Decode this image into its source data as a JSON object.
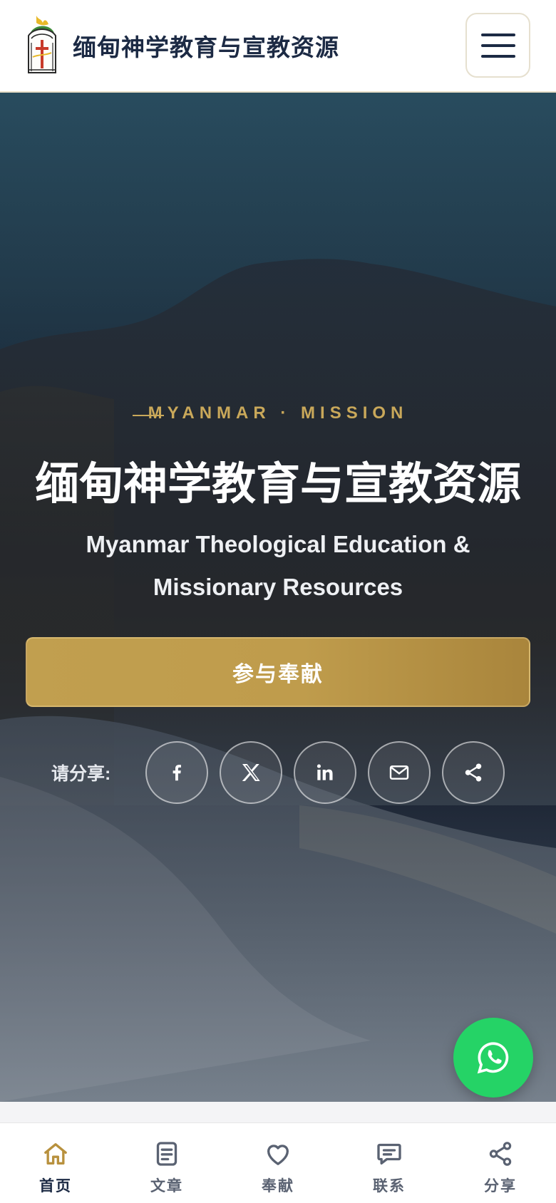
{
  "header": {
    "site_title": "缅甸神学教育与宣教资源",
    "logo_icon": "cross-emblem-icon",
    "menu_icon": "hamburger-menu-icon"
  },
  "hero": {
    "eyebrow": "MYANMAR · MISSION",
    "title": "缅甸神学教育与宣教资源",
    "subtitle": "Myanmar Theological Education & Missionary Resources",
    "cta_label": "参与奉献",
    "share_label": "请分享:",
    "share_buttons": [
      "facebook-icon",
      "x-twitter-icon",
      "linkedin-icon",
      "email-icon",
      "share-icon"
    ]
  },
  "floating": {
    "whatsapp_icon": "whatsapp-icon"
  },
  "bottom_nav": {
    "items": [
      {
        "label": "首页",
        "icon": "home-icon",
        "active": true
      },
      {
        "label": "文章",
        "icon": "article-icon",
        "active": false
      },
      {
        "label": "奉献",
        "icon": "heart-icon",
        "active": false
      },
      {
        "label": "联系",
        "icon": "chat-icon",
        "active": false
      },
      {
        "label": "分享",
        "icon": "share-icon",
        "active": false
      }
    ]
  },
  "colors": {
    "navy": "#1c2a44",
    "gold": "#c9a85a",
    "cta_gold": "#bf9c4c",
    "whatsapp_green": "#25d366",
    "active_icon_gold": "#b8913e"
  }
}
